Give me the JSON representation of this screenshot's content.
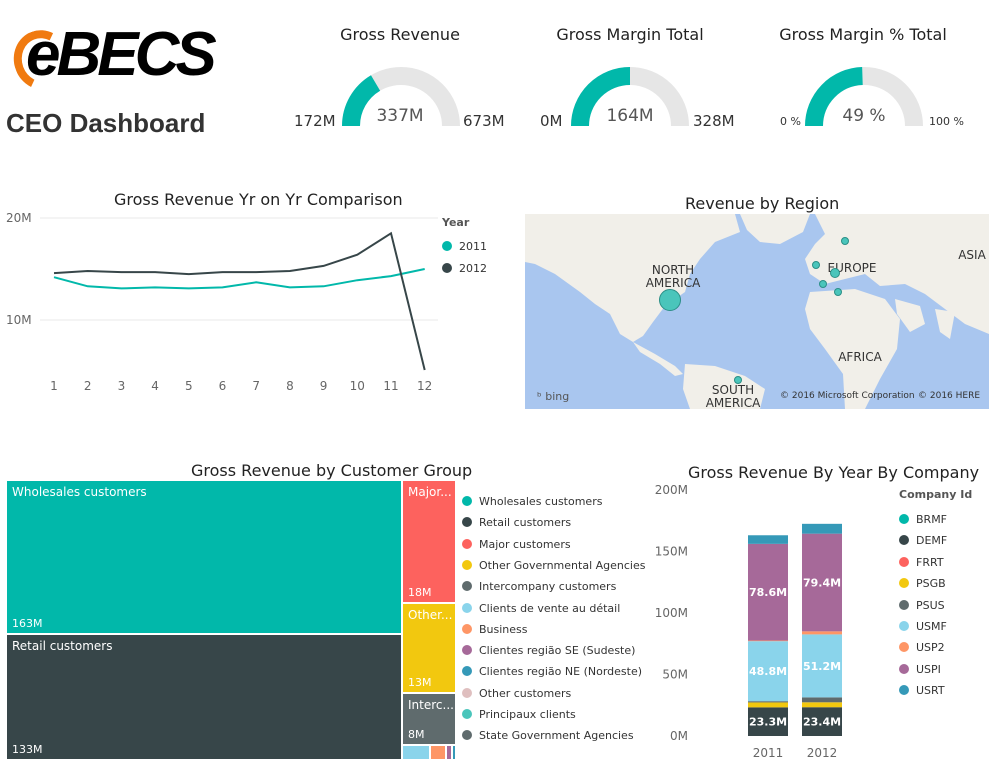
{
  "header": {
    "logo_text": "eBECS",
    "page_title": "CEO Dashboard"
  },
  "gauges": [
    {
      "title": "Gross Revenue",
      "min": "172M",
      "value": "337M",
      "max": "673M",
      "fraction": 0.33
    },
    {
      "title": "Gross Margin Total",
      "min": "0M",
      "value": "164M",
      "max": "328M",
      "fraction": 0.5
    },
    {
      "title": "Gross Margin % Total",
      "min": "0 %",
      "value": "49 %",
      "max": "100 %",
      "fraction": 0.49
    }
  ],
  "colors": {
    "teal": "#01b8aa",
    "dark": "#374649",
    "gauge_bg": "#e6e6e6",
    "map_water": "#a9c6ef"
  },
  "yoy_chart": {
    "title": "Gross Revenue Yr on Yr Comparison",
    "legend_title": "Year",
    "legend": [
      "2011",
      "2012"
    ]
  },
  "map_panel": {
    "title": "Revenue by Region",
    "labels": [
      "NORTH AMERICA",
      "EUROPE",
      "ASIA",
      "AFRICA",
      "SOUTH AMERICA"
    ],
    "bing": "bing",
    "copyright1": "© 2016 Microsoft Corporation",
    "copyright2": "© 2016 HERE"
  },
  "treemap": {
    "title": "Gross Revenue by Customer Group",
    "cells": [
      {
        "label": "Wholesales customers",
        "value": "163M",
        "color": "#01b8aa"
      },
      {
        "label": "Retail customers",
        "value": "133M",
        "color": "#374649"
      },
      {
        "label": "Major...",
        "value": "18M",
        "color": "#fd625e"
      },
      {
        "label": "Other...",
        "value": "13M",
        "color": "#f2c80f"
      },
      {
        "label": "Interc...",
        "value": "8M",
        "color": "#5f6b6d"
      }
    ],
    "legend": [
      {
        "label": "Wholesales customers",
        "color": "#01b8aa"
      },
      {
        "label": "Retail customers",
        "color": "#374649"
      },
      {
        "label": "Major customers",
        "color": "#fd625e"
      },
      {
        "label": "Other Governmental Agencies",
        "color": "#f2c80f"
      },
      {
        "label": "Intercompany customers",
        "color": "#5f6b6d"
      },
      {
        "label": "Clients de vente au détail",
        "color": "#8ad4eb"
      },
      {
        "label": "Business",
        "color": "#fe9666"
      },
      {
        "label": "Clientes região SE (Sudeste)",
        "color": "#a66999"
      },
      {
        "label": "Clientes região NE (Nordeste)",
        "color": "#3599b8"
      },
      {
        "label": "Other customers",
        "color": "#dfbfbf"
      },
      {
        "label": "Principaux clients",
        "color": "#4ac5bb"
      },
      {
        "label": "State Government Agencies",
        "color": "#5f6b6d"
      }
    ]
  },
  "company_chart": {
    "title": "Gross Revenue By Year By Company",
    "legend_title": "Company Id",
    "legend": [
      {
        "label": "BRMF",
        "color": "#01b8aa"
      },
      {
        "label": "DEMF",
        "color": "#374649"
      },
      {
        "label": "FRRT",
        "color": "#fd625e"
      },
      {
        "label": "PSGB",
        "color": "#f2c80f"
      },
      {
        "label": "PSUS",
        "color": "#5f6b6d"
      },
      {
        "label": "USMF",
        "color": "#8ad4eb"
      },
      {
        "label": "USP2",
        "color": "#fe9666"
      },
      {
        "label": "USPI",
        "color": "#a66999"
      },
      {
        "label": "USRT",
        "color": "#3599b8"
      }
    ]
  },
  "chart_data": [
    {
      "type": "line",
      "title": "Gross Revenue Yr on Yr Comparison",
      "x": [
        1,
        2,
        3,
        4,
        5,
        6,
        7,
        8,
        9,
        10,
        11,
        12
      ],
      "y_ticks": [
        "10M",
        "20M"
      ],
      "ylim": [
        5,
        20
      ],
      "legend_title": "Year",
      "legend_position": "right",
      "series": [
        {
          "name": "2011",
          "color": "#01b8aa",
          "values": [
            14.2,
            13.3,
            13.1,
            13.2,
            13.1,
            13.2,
            13.7,
            13.2,
            13.3,
            13.9,
            14.3,
            15.0
          ]
        },
        {
          "name": "2012",
          "color": "#374649",
          "values": [
            14.6,
            14.8,
            14.7,
            14.7,
            14.5,
            14.7,
            14.7,
            14.8,
            15.3,
            16.4,
            18.5,
            5.1
          ]
        }
      ]
    },
    {
      "type": "bar",
      "stacked": true,
      "title": "Gross Revenue By Year By Company",
      "categories": [
        "2011",
        "2012"
      ],
      "y_ticks": [
        "0M",
        "50M",
        "100M",
        "150M",
        "200M"
      ],
      "ylim": [
        0,
        200
      ],
      "legend_title": "Company Id",
      "legend_position": "right",
      "series": [
        {
          "name": "DEMF",
          "color": "#374649",
          "values": [
            23.3,
            23.4
          ],
          "labels": [
            "23.3M",
            "23.4M"
          ]
        },
        {
          "name": "PSGB",
          "color": "#f2c80f",
          "values": [
            4,
            4
          ]
        },
        {
          "name": "PSUS",
          "color": "#5f6b6d",
          "values": [
            1,
            4
          ]
        },
        {
          "name": "USMF",
          "color": "#8ad4eb",
          "values": [
            48.8,
            51.2
          ],
          "labels": [
            "48.8M",
            "51.2M"
          ]
        },
        {
          "name": "USP2",
          "color": "#fe9666",
          "values": [
            0.5,
            2.5
          ]
        },
        {
          "name": "USPI",
          "color": "#a66999",
          "values": [
            78.6,
            79.4
          ],
          "labels": [
            "78.6M",
            "79.4M"
          ]
        },
        {
          "name": "USRT",
          "color": "#3599b8",
          "values": [
            7,
            8
          ]
        }
      ]
    },
    {
      "type": "heatmap",
      "title": "Gross Revenue by Customer Group",
      "labels": [
        "Wholesales customers",
        "Retail customers",
        "Major customers",
        "Other Governmental Agencies",
        "Intercompany customers"
      ],
      "values": [
        163,
        133,
        18,
        13,
        8
      ]
    }
  ]
}
